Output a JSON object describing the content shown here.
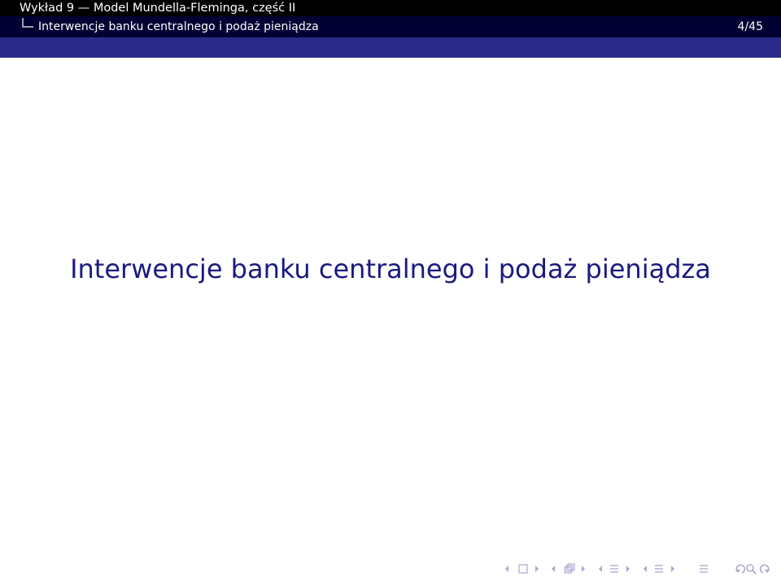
{
  "header": {
    "presentation_title": "Wykład 9 — Model Mundella-Fleminga, część II",
    "section_title": "Interwencje banku centralnego i podaż pieniądza",
    "page_counter": "4/45"
  },
  "slide": {
    "title": "Interwencje banku centralnego i podaż pieniądza"
  },
  "colors": {
    "header_top": "#000000",
    "header_bottom": "#000033",
    "band": "#2a2a88",
    "title_text": "#1a1a80",
    "nav_icons": "#a8a8d0"
  },
  "navigation": {
    "icons": [
      "prev-frame-icon",
      "frame-icon",
      "next-frame-icon",
      "prev-subsection-icon",
      "subsection-icon",
      "next-subsection-icon",
      "prev-section-icon",
      "section-icon",
      "next-section-icon",
      "prev-page-icon",
      "page-icon",
      "next-page-icon",
      "align-icon",
      "back-icon",
      "search-icon",
      "forward-icon"
    ]
  }
}
